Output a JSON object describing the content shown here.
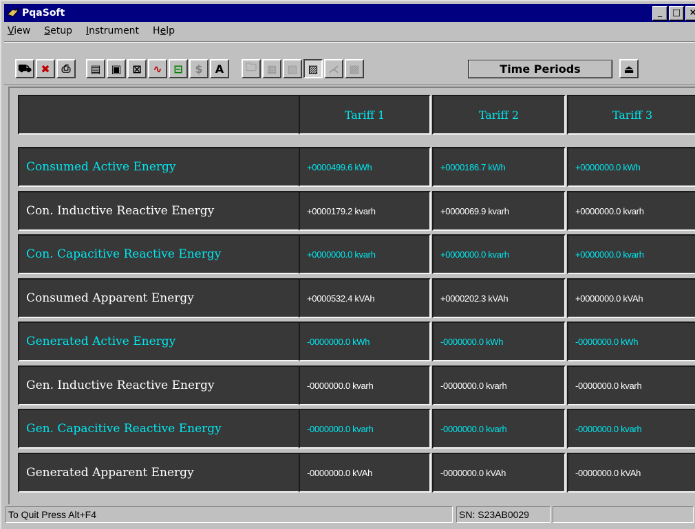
{
  "window": {
    "title": "PqaSoft",
    "minimize": "_",
    "maximize": "□",
    "close": "×"
  },
  "menu": [
    {
      "accel": "V",
      "rest": "iew"
    },
    {
      "accel": "S",
      "rest": "etup"
    },
    {
      "accel": "I",
      "rest": "nstrument"
    },
    {
      "accel": "",
      "rest": "Help",
      "underline_index": 1
    }
  ],
  "toolbar": {
    "time_periods_label": "Time Periods",
    "buttons": [
      {
        "name": "connect-icon",
        "glyph": "⛟"
      },
      {
        "name": "disconnect-icon",
        "glyph": "✖"
      },
      {
        "name": "print-icon",
        "glyph": "⎙"
      },
      {
        "name": "document-icon",
        "glyph": "▤"
      },
      {
        "name": "monitor-icon",
        "glyph": "▣"
      },
      {
        "name": "chart-icon",
        "glyph": "⊠"
      },
      {
        "name": "waveform-icon",
        "glyph": "∿"
      },
      {
        "name": "harmonics-icon",
        "glyph": "⊟"
      },
      {
        "name": "dollar-icon",
        "glyph": "$"
      },
      {
        "name": "font-icon",
        "glyph": "A"
      },
      {
        "name": "open-folder-icon",
        "glyph": "🗀"
      },
      {
        "name": "grid-icon",
        "glyph": "▦"
      },
      {
        "name": "graph-icon",
        "glyph": "▧"
      },
      {
        "name": "energy-icon",
        "glyph": "▨"
      },
      {
        "name": "trend-icon",
        "glyph": "⋌"
      },
      {
        "name": "report-icon",
        "glyph": "▩"
      },
      {
        "name": "exit-icon",
        "glyph": "⏏"
      }
    ]
  },
  "table": {
    "headers": [
      "Tariff 1",
      "Tariff 2",
      "Tariff 3"
    ],
    "rows": [
      {
        "label": "Consumed Active Energy",
        "color": "cyan",
        "values": [
          "+0000499.6 kWh",
          "+0000186.7 kWh",
          "+0000000.0 kWh"
        ]
      },
      {
        "label": "Con. Inductive Reactive Energy",
        "color": "white",
        "values": [
          "+0000179.2 kvarh",
          "+0000069.9 kvarh",
          "+0000000.0 kvarh"
        ]
      },
      {
        "label": "Con. Capacitive Reactive Energy",
        "color": "cyan",
        "values": [
          "+0000000.0 kvarh",
          "+0000000.0 kvarh",
          "+0000000.0 kvarh"
        ]
      },
      {
        "label": "Consumed Apparent Energy",
        "color": "white",
        "values": [
          "+0000532.4 kVAh",
          "+0000202.3 kVAh",
          "+0000000.0 kVAh"
        ]
      },
      {
        "label": "Generated Active Energy",
        "color": "cyan",
        "values": [
          "-0000000.0 kWh",
          "-0000000.0 kWh",
          "-0000000.0 kWh"
        ]
      },
      {
        "label": "Gen. Inductive Reactive Energy",
        "color": "white",
        "values": [
          "-0000000.0 kvarh",
          "-0000000.0 kvarh",
          "-0000000.0 kvarh"
        ]
      },
      {
        "label": "Gen. Capacitive Reactive Energy",
        "color": "cyan",
        "values": [
          "-0000000.0 kvarh",
          "-0000000.0 kvarh",
          "-0000000.0 kvarh"
        ]
      },
      {
        "label": "Generated Apparent Energy",
        "color": "white",
        "values": [
          "-0000000.0 kVAh",
          "-0000000.0 kVAh",
          "-0000000.0 kVAh"
        ]
      }
    ]
  },
  "status": {
    "left": "To Quit Press Alt+F4",
    "serial": "SN: S23AB0029"
  },
  "colors": {
    "titlebar": "#000080",
    "cyan_text": "#00e8f0",
    "cell_bg": "#383838",
    "face": "#c0c0c0"
  }
}
